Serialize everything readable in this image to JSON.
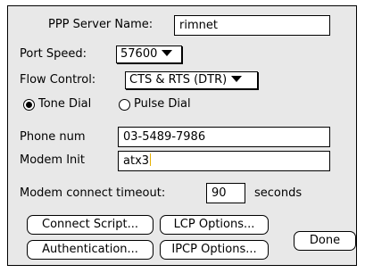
{
  "server": {
    "label": "PPP Server Name:",
    "value": "rimnet"
  },
  "port_speed": {
    "label": "Port Speed:",
    "value": "57600"
  },
  "flow_control": {
    "label": "Flow Control:",
    "value": "CTS & RTS (DTR)"
  },
  "dial": {
    "tone_label": "Tone Dial",
    "pulse_label": "Pulse Dial",
    "selected": "tone"
  },
  "phone": {
    "label": "Phone num",
    "value": "03-5489-7986"
  },
  "modem_init": {
    "label": "Modem Init",
    "value": "atx3"
  },
  "timeout": {
    "label": "Modem connect timeout:",
    "value": "90",
    "unit": "seconds"
  },
  "buttons": {
    "connect_script": "Connect Script...",
    "lcp_options": "LCP Options...",
    "authentication": "Authentication...",
    "ipcp_options": "IPCP Options...",
    "done": "Done"
  }
}
